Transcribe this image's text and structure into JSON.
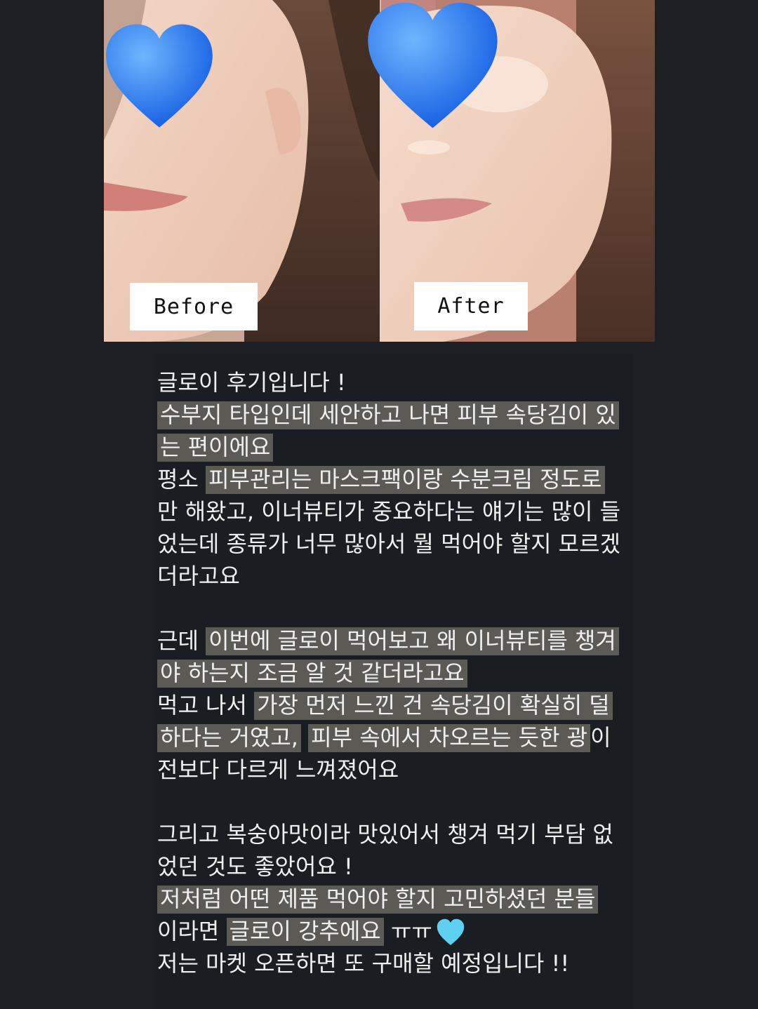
{
  "photos": {
    "before_label": "Before",
    "after_label": "After"
  },
  "review": {
    "p1_line1": "글로이 후기입니다 !",
    "p1_hl1": "수부지 타입인데 세안하고 나면 피부 속당김이 있는 편이에요",
    "p1_pre2": "평소 ",
    "p1_hl2": "피부관리는 마스크팩이랑 수분크림 정도로",
    "p1_rest2": " 만 해왔고, 이너뷰티가 중요하다는 얘기는 많이 들었는데 종류가 너무 많아서 뭘 먹어야 할지 모르겠더라고요",
    "p2_pre1": "근데 ",
    "p2_hl1": "이번에 글로이 먹어보고 왜 이너뷰티를 챙겨야 하는지 조금 알 것 같더라고요",
    "p2_pre2": "먹고 나서 ",
    "p2_hl2": "가장 먼저 느낀 건 속당김이 확실히 덜하다는 거였고,",
    "p2_mid2": " ",
    "p2_hl3": "피부 속에서 차오르는 듯한 광",
    "p2_rest2": "이 전보다 다르게 느껴졌어요",
    "p3_line1": "그리고 복숭아맛이라 맛있어서 챙겨 먹기 부담 없었던 것도 좋았어요 !",
    "p3_hl1": "저처럼 어떤 제품 먹어야 할지 고민하셨던 분들",
    "p3_pre2": "이라면 ",
    "p3_hl2": "글로이 강추에요",
    "p3_rest2": " ㅠㅠ",
    "p3_last": "저는 마켓 오픈하면 또 구매할 예정입니다 !!"
  },
  "icons": {
    "face_cover": "blue-heart-icon",
    "emoji": "light-blue-heart-icon"
  },
  "colors": {
    "background": "#1c2024",
    "highlight": "#5b5a54",
    "heart_blue": "#1a6cf0",
    "heart_light": "#5fd0f0"
  }
}
